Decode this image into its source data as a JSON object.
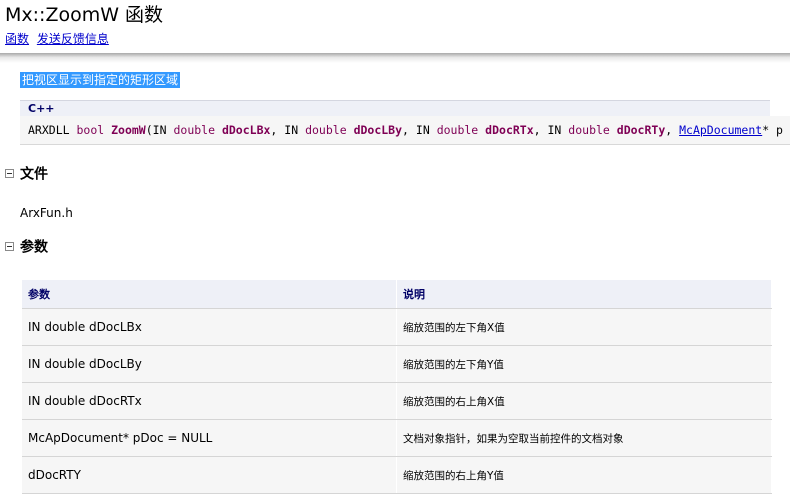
{
  "page": {
    "title": "Mx::ZoomW 函数"
  },
  "nav": {
    "links": [
      "函数",
      "发送反馈信息"
    ]
  },
  "summary": "把视区显示到指定的矩形区域",
  "code": {
    "language": "C++",
    "signature": {
      "prefix": "ARXDLL ",
      "return_type": "bool",
      "function_name": "ZoomW",
      "open_paren": "(",
      "in_keyword": "IN",
      "double_keyword": "double",
      "params": [
        "dDocLBx",
        "dDocLBy",
        "dDocRTx",
        "dDocRTy"
      ],
      "sep": ", ",
      "doc_type": "McApDocument",
      "doc_rest": "* p"
    }
  },
  "sections": {
    "file": {
      "title": "文件",
      "value": "ArxFun.h"
    },
    "params": {
      "title": "参数"
    }
  },
  "param_table": {
    "headers": [
      "参数",
      "说明"
    ],
    "rows": [
      [
        "IN double dDocLBx",
        "缩放范围的左下角X值"
      ],
      [
        "IN double dDocLBy",
        "缩放范围的左下角Y值"
      ],
      [
        "IN double dDocRTx",
        "缩放范围的右上角X值"
      ],
      [
        "McApDocument* pDoc = NULL",
        "文档对象指针，如果为空取当前控件的文档对象"
      ],
      [
        "dDocRTY",
        "缩放范围的右上角Y值"
      ]
    ]
  },
  "colors": {
    "link": "#0000cc",
    "highlight": "#3399ff",
    "keyword": "#7f0055",
    "table_header_text": "#000066",
    "table_header_bg": "#eef0f7",
    "table_cell_bg": "#f6f6f6"
  }
}
